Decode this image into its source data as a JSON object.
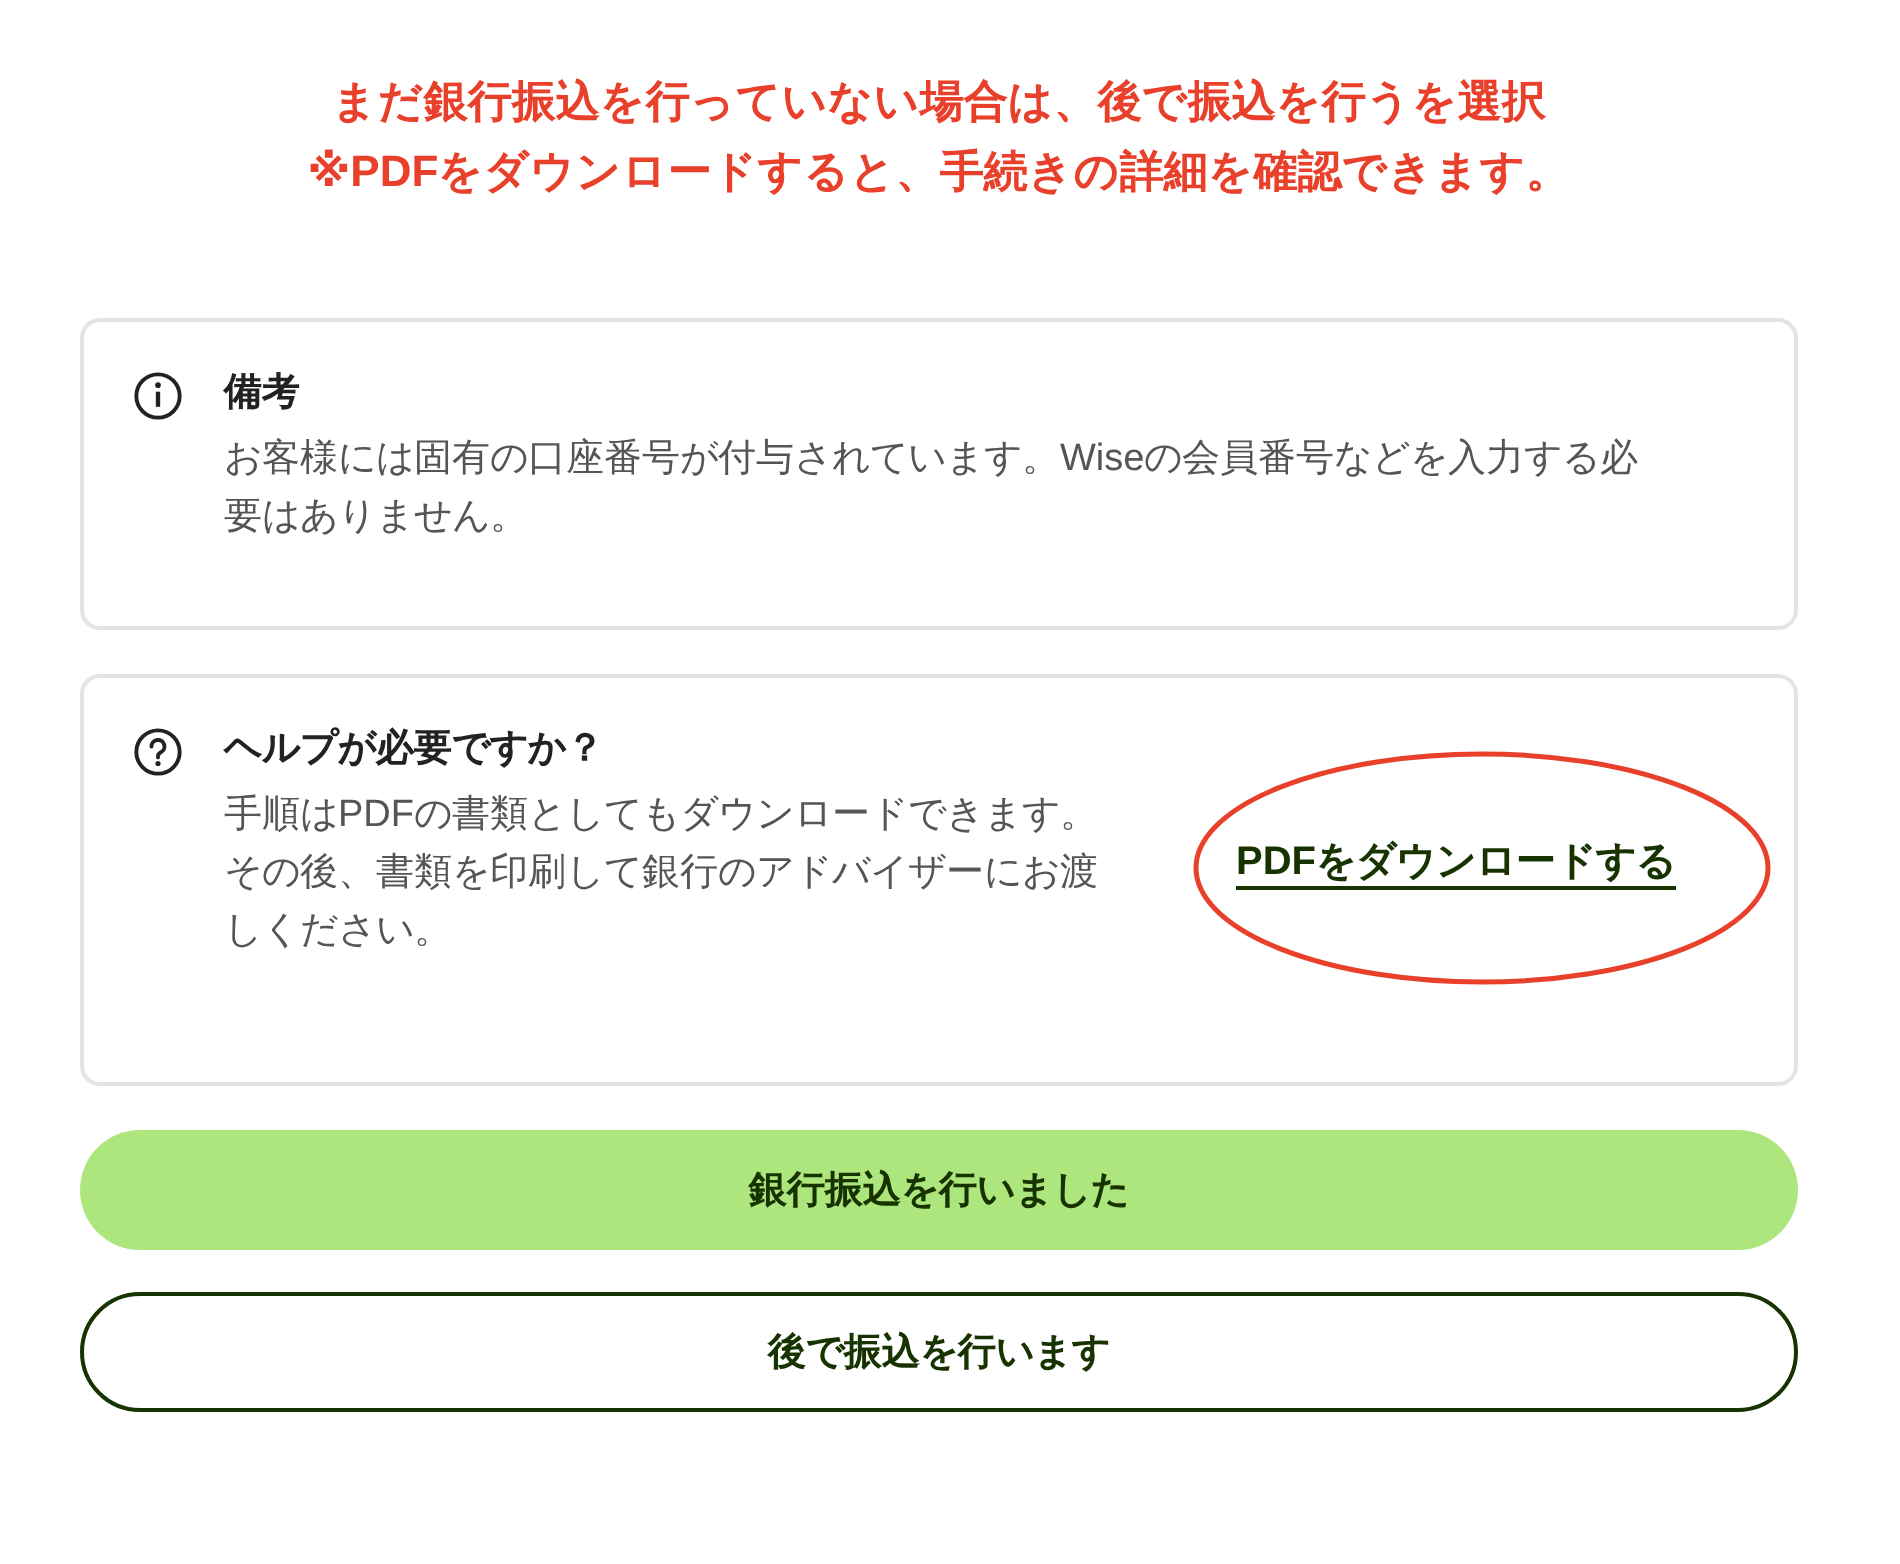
{
  "annotation": {
    "lines": [
      "まだ銀行振込を行っていない場合は、後で振込を行うを選択",
      "※PDFをダウンロードすると、手続きの詳細を確認できます。"
    ]
  },
  "cards": [
    {
      "kind": "info",
      "title": "備考",
      "body": "お客様には固有の口座番号が付与されています。Wiseの会員番号などを入力する必要はありません。"
    },
    {
      "kind": "help",
      "title": "ヘルプが必要ですか？",
      "body": "手順はPDFの書類としてもダウンロードできます。その後、書類を印刷して銀行のアドバイザーにお渡しください。",
      "link": "PDFをダウンロードする",
      "circled": true
    }
  ],
  "buttons": [
    {
      "label": "銀行振込を行いました",
      "kind": "primary"
    },
    {
      "label": "後で振込を行います",
      "kind": "secondary"
    }
  ]
}
